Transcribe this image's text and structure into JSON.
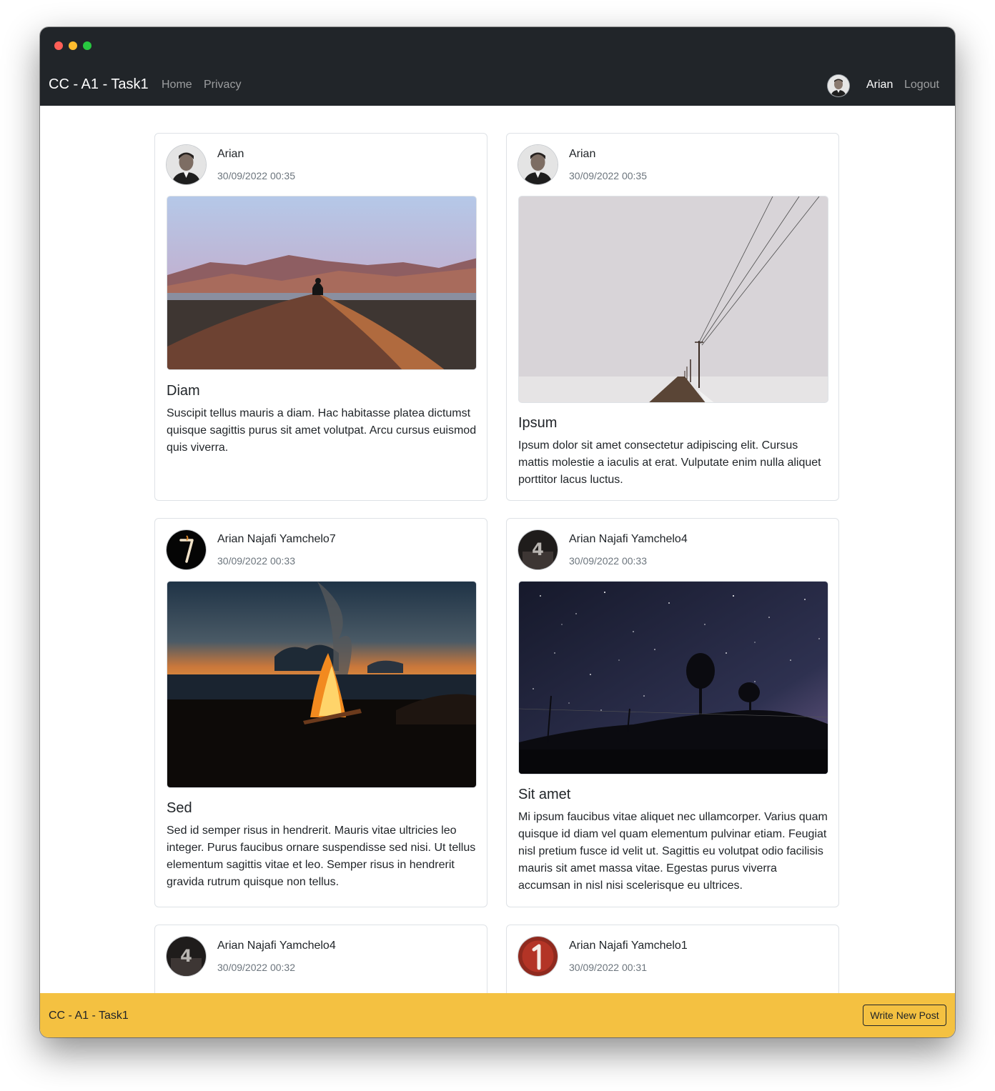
{
  "navbar": {
    "brand": "CC - A1 - Task1",
    "links": [
      "Home",
      "Privacy"
    ],
    "user": "Arian",
    "logout": "Logout"
  },
  "posts": [
    {
      "author": "Arian",
      "date": "30/09/2022 00:35",
      "title": "Diam",
      "text": "Suscipit tellus mauris a diam. Hac habitasse platea dictumst quisque sagittis purus sit amet volutpat. Arcu cursus euismod quis viverra.",
      "avatar": "person-photo-icon",
      "image": "desert-dunes-photo"
    },
    {
      "author": "Arian",
      "date": "30/09/2022 00:35",
      "title": "Ipsum",
      "text": "Ipsum dolor sit amet consectetur adipiscing elit. Cursus mattis molestie a iaculis at erat. Vulputate enim nulla aliquet porttitor lacus luctus.",
      "avatar": "person-photo-icon",
      "image": "snowy-road-power-lines-photo"
    },
    {
      "author": "Arian Najafi Yamchelo7",
      "date": "30/09/2022 00:33",
      "title": "Sed",
      "text": "Sed id semper risus in hendrerit. Mauris vitae ultricies leo integer. Purus faucibus ornare suspendisse sed nisi. Ut tellus elementum sagittis vitae et leo. Semper risus in hendrerit gravida rutrum quisque non tellus.",
      "avatar": "number-seven-icon",
      "image": "campfire-sunset-photo"
    },
    {
      "author": "Arian Najafi Yamchelo4",
      "date": "30/09/2022 00:33",
      "title": "Sit amet",
      "text": "Mi ipsum faucibus vitae aliquet nec ullamcorper. Varius quam quisque id diam vel quam elementum pulvinar etiam. Feugiat nisl pretium fusce id velit ut. Sagittis eu volutpat odio facilisis mauris sit amet massa vitae. Egestas purus viverra accumsan in nisl nisi scelerisque eu ultrices.",
      "avatar": "number-four-icon",
      "image": "starry-night-trees-photo"
    },
    {
      "author": "Arian Najafi Yamchelo4",
      "date": "30/09/2022 00:32",
      "avatar": "number-four-icon"
    },
    {
      "author": "Arian Najafi Yamchelo1",
      "date": "30/09/2022 00:31",
      "avatar": "number-one-icon"
    }
  ],
  "footer": {
    "brand": "CC - A1 - Task1",
    "button": "Write New Post"
  },
  "colors": {
    "navbar": "#212529",
    "footer": "#f4c141",
    "muted": "#6c757d",
    "border": "#dee2e6"
  }
}
